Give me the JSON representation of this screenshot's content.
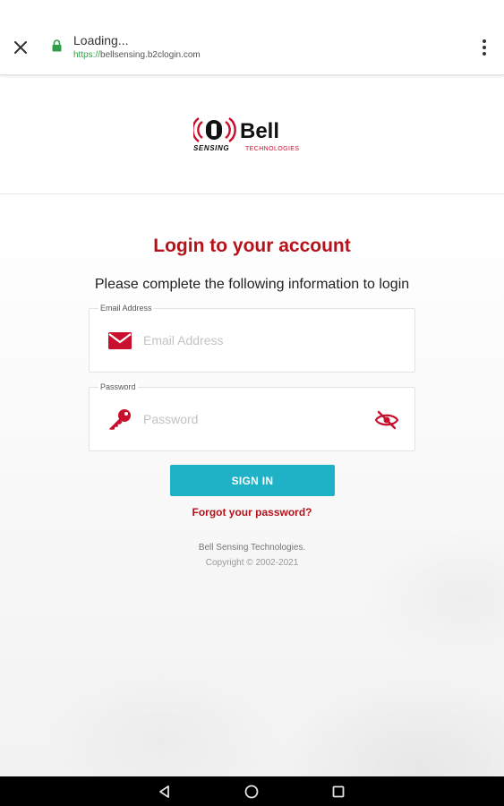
{
  "browser": {
    "title": "Loading...",
    "url_scheme": "https://",
    "url_host": "bellsensing.b2clogin.com",
    "close_icon": "close-icon",
    "lock_icon": "lock-icon",
    "menu_icon": "more-vertical-icon"
  },
  "brand": {
    "name": "Bell",
    "tagline_bold": "SENSING",
    "tagline_light": "TECHNOLOGIES",
    "primary_color": "#b5121b",
    "accent_color": "#1fb1c5"
  },
  "login": {
    "title": "Login to your account",
    "subtitle": "Please complete the following information to login",
    "email": {
      "label": "Email Address",
      "placeholder": "Email Address",
      "value": "",
      "icon": "envelope-icon"
    },
    "password": {
      "label": "Password",
      "placeholder": "Password",
      "value": "",
      "icon": "key-icon",
      "toggle_icon": "eye-off-icon"
    },
    "signin_label": "SIGN IN",
    "forgot_label": "Forgot your password?"
  },
  "footer": {
    "company": "Bell Sensing Technologies.",
    "copyright": "Copyright © 2002-2021"
  },
  "navbar": {
    "back_icon": "back-triangle-icon",
    "home_icon": "home-circle-icon",
    "recents_icon": "recents-square-icon"
  }
}
